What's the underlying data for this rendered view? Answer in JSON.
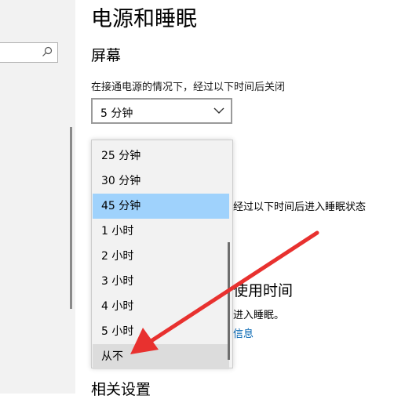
{
  "page": {
    "title": "电源和睡眠",
    "screen_section": "屏幕",
    "screen_label": "在接通电源的情况下，经过以下时间后关闭",
    "screen_value": "5 分钟",
    "sleep_partial_label": "经过以下时间后进入睡眠状态",
    "partial_heading": "使用时间",
    "partial_text": "进入睡眠。",
    "partial_link": "信息",
    "related_settings": "相关设置"
  },
  "dropdown": {
    "options": [
      "25 分钟",
      "30 分钟",
      "45 分钟",
      "1 小时",
      "2 小时",
      "3 小时",
      "4 小时",
      "5 小时",
      "从不"
    ],
    "selected": "45 分钟",
    "hovered": "从不"
  },
  "colors": {
    "selected_bg": "#9fd2fc",
    "hover_bg": "#dcdcdc",
    "link": "#0063b1",
    "arrow": "#e8312f"
  }
}
